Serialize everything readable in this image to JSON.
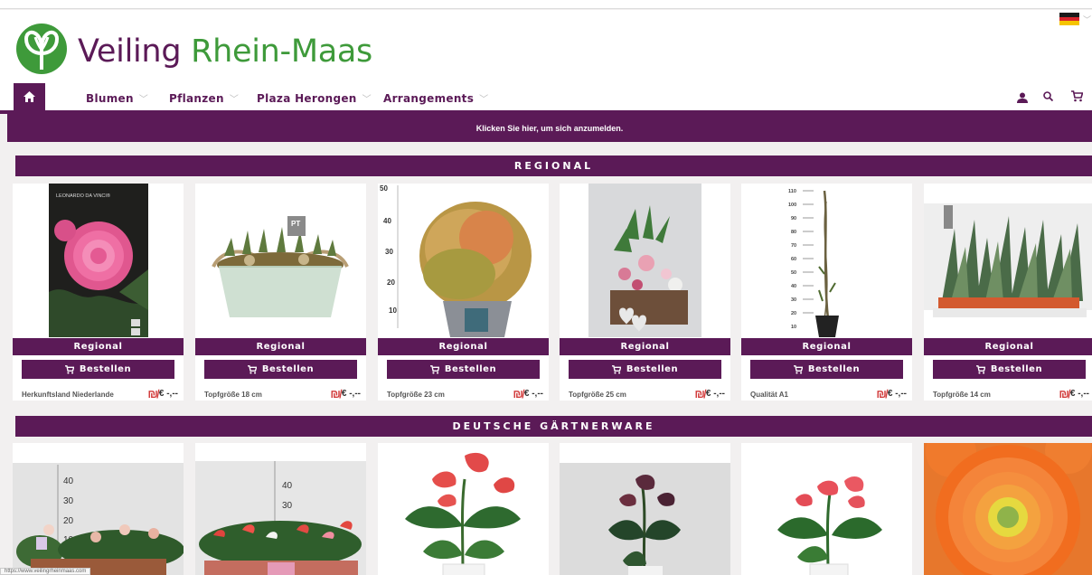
{
  "header": {
    "brand_word1": "Veiling",
    "brand_word2": "Rhein-Maas",
    "language_flag": "flag-de-icon"
  },
  "nav": {
    "home_icon": "home-icon",
    "items": [
      {
        "label": "Blumen"
      },
      {
        "label": "Pflanzen"
      },
      {
        "label": "Plaza Herongen"
      },
      {
        "label": "Arrangements"
      }
    ],
    "right_icons": [
      "user-icon",
      "search-icon",
      "cart-icon"
    ]
  },
  "login_bar": {
    "text": "Klicken Sie hier, um sich anzumelden."
  },
  "sections": [
    {
      "title": "REGIONAL",
      "products": [
        {
          "tag": "Regional",
          "order_label": "Bestellen",
          "info": "Herkunftsland Niederlande",
          "price": "€ -,--"
        },
        {
          "tag": "Regional",
          "order_label": "Bestellen",
          "info": "Topfgröße 18 cm",
          "price": "€ -,--"
        },
        {
          "tag": "Regional",
          "order_label": "Bestellen",
          "info": "Topfgröße 23 cm",
          "price": "€ -,--"
        },
        {
          "tag": "Regional",
          "order_label": "Bestellen",
          "info": "Topfgröße 25 cm",
          "price": "€ -,--"
        },
        {
          "tag": "Regional",
          "order_label": "Bestellen",
          "info": "Qualität A1",
          "price": "€ -,--"
        },
        {
          "tag": "Regional",
          "order_label": "Bestellen",
          "info": "Topfgröße 14 cm",
          "price": "€ -,--"
        }
      ]
    },
    {
      "title": "DEUTSCHE GÄRTNERWARE"
    }
  ],
  "image_text": {
    "book_brand": "LEONARDO DA VINCI®",
    "pt_label": "PT",
    "ruler_50": "50",
    "ruler_40": "40",
    "ruler_30": "30",
    "ruler_20": "20",
    "ruler_10": "10",
    "tall_110": "110",
    "tall_100": "100",
    "tall_90": "90",
    "tall_80": "80",
    "tall_70": "70",
    "tall_60": "60",
    "tall_50": "50",
    "tall_40": "40",
    "tall_30": "30",
    "tall_20": "20",
    "tall_10": "10"
  },
  "status_bar": {
    "url": "https://www.veilingrheinmaas.com"
  },
  "colors": {
    "brand_purple": "#5b1a57",
    "brand_green": "#3e9a3a"
  }
}
